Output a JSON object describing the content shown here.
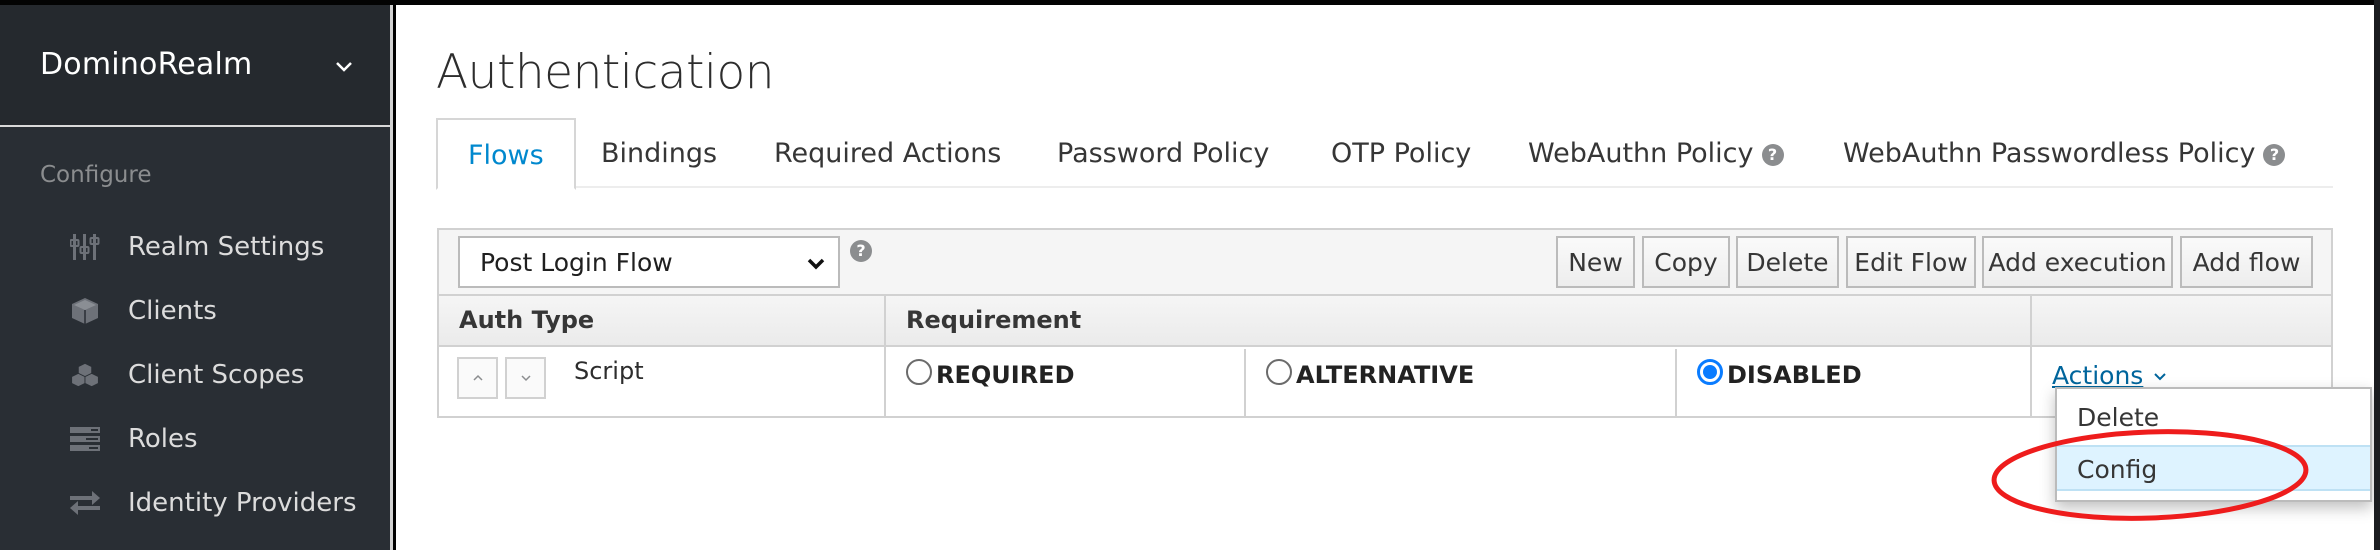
{
  "sidebar": {
    "realm": "DominoRealm",
    "section": "Configure",
    "items": [
      {
        "label": "Realm Settings",
        "icon": "sliders-icon"
      },
      {
        "label": "Clients",
        "icon": "cube-icon"
      },
      {
        "label": "Client Scopes",
        "icon": "cubes-icon"
      },
      {
        "label": "Roles",
        "icon": "server-icon"
      },
      {
        "label": "Identity Providers",
        "icon": "exchange-icon"
      }
    ]
  },
  "page": {
    "title": "Authentication",
    "tabs": [
      {
        "label": "Flows",
        "active": true
      },
      {
        "label": "Bindings"
      },
      {
        "label": "Required Actions"
      },
      {
        "label": "Password Policy"
      },
      {
        "label": "OTP Policy"
      },
      {
        "label": "WebAuthn Policy",
        "help": true
      },
      {
        "label": "WebAuthn Passwordless Policy",
        "help": true
      }
    ]
  },
  "toolbar": {
    "flow_selected": "Post Login Flow",
    "help_glyph": "?",
    "buttons": [
      "New",
      "Copy",
      "Delete",
      "Edit Flow",
      "Add execution",
      "Add flow"
    ]
  },
  "table": {
    "headers": [
      "Auth Type",
      "Requirement",
      ""
    ],
    "rows": [
      {
        "auth_type": "Script",
        "requirements": [
          {
            "label": "REQUIRED",
            "checked": false
          },
          {
            "label": "ALTERNATIVE",
            "checked": false
          },
          {
            "label": "DISABLED",
            "checked": true
          }
        ],
        "actions_label": "Actions"
      }
    ]
  },
  "actions_menu": {
    "items": [
      "Delete",
      "Config"
    ],
    "highlighted": "Config"
  },
  "colors": {
    "sidebar_bg": "#292e34",
    "active_tab": "#0088ce",
    "link": "#00659c",
    "radio_checked": "#0a7cff",
    "menu_hover": "#def3ff",
    "annotation": "#ee1c1c"
  }
}
